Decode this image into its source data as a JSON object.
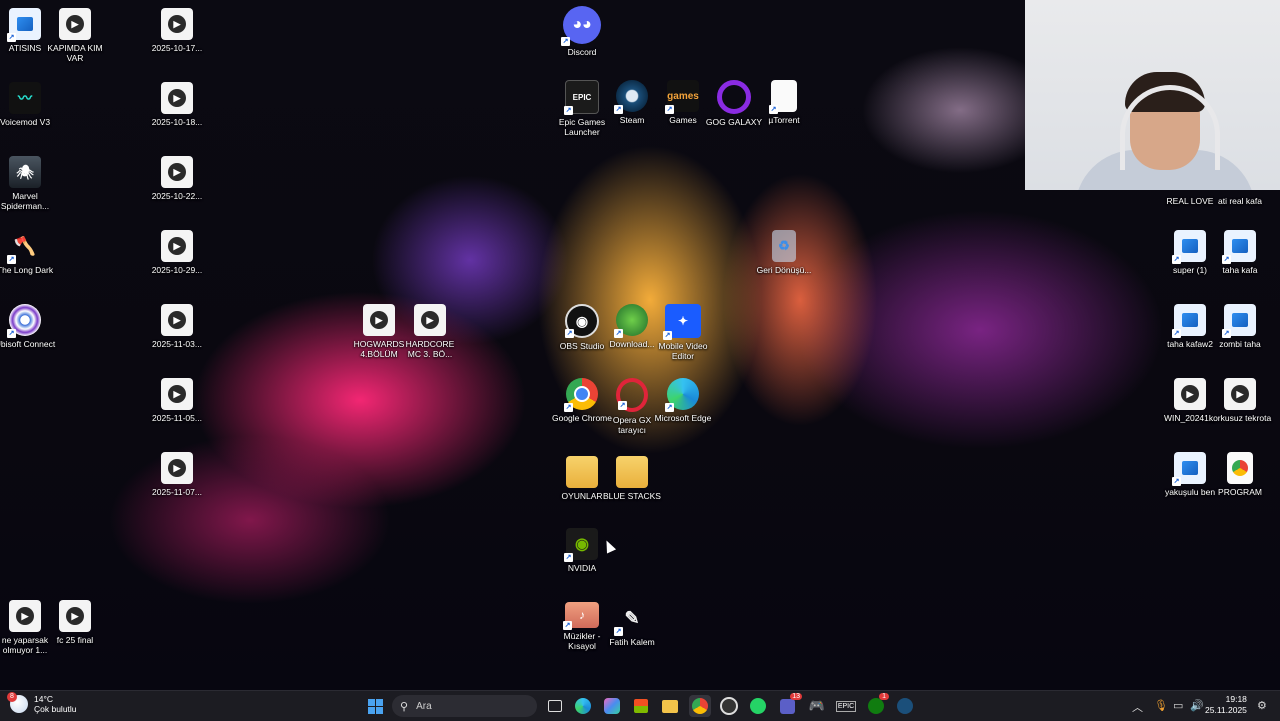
{
  "desktop": {
    "icons": {
      "atisins": {
        "label": "ATISINS"
      },
      "kapimda": {
        "label": "KAPIMDA KIM VAR"
      },
      "voicemod": {
        "label": "Voicemod V3"
      },
      "spiderman": {
        "label": "Marvel Spiderman..."
      },
      "longdark": {
        "label": "The Long Dark"
      },
      "ubisoft": {
        "label": "Ubisoft Connect"
      },
      "v1017": {
        "label": "2025-10-17..."
      },
      "v1018": {
        "label": "2025-10-18..."
      },
      "v1022": {
        "label": "2025-10-22..."
      },
      "v1029": {
        "label": "2025-10-29..."
      },
      "v1103": {
        "label": "2025-11-03..."
      },
      "v1105": {
        "label": "2025-11-05..."
      },
      "v1107": {
        "label": "2025-11-07..."
      },
      "neyaparsak": {
        "label": "ne yaparsak olmuyor 1..."
      },
      "fc25": {
        "label": "fc 25 final"
      },
      "hogwards": {
        "label": "HOGWARDS 4.BÖLÜM"
      },
      "hardcore": {
        "label": "HARDCORE MC 3. BÖ..."
      },
      "discord": {
        "label": "Discord"
      },
      "epic": {
        "label": "Epic Games Launcher"
      },
      "steam": {
        "label": "Steam"
      },
      "amazon": {
        "label": "Games"
      },
      "gog": {
        "label": "GOG GALAXY"
      },
      "utorrent": {
        "label": "µTorrent"
      },
      "recycle": {
        "label": "Geri Dönüşü..."
      },
      "obs": {
        "label": "OBS Studio"
      },
      "download": {
        "label": "Download..."
      },
      "vlc": {
        "label": "Mobile Video Editor"
      },
      "chrome": {
        "label": "Google Chrome"
      },
      "operagx": {
        "label": "Opera GX tarayıcı"
      },
      "edge": {
        "label": "Microsoft Edge"
      },
      "oyunlar": {
        "label": "OYUNLAR"
      },
      "bluestacks": {
        "label": "BLUE STACKS"
      },
      "nvidia": {
        "label": "NVIDIA"
      },
      "muzikler": {
        "label": "Müzikler - Kısayol"
      },
      "fatih": {
        "label": "Fatih Kalem"
      },
      "reallove": {
        "label": "REAL LOVE"
      },
      "atireal": {
        "label": "ati real kafa"
      },
      "super1": {
        "label": "super (1)"
      },
      "tahakafa": {
        "label": "taha kafa"
      },
      "tahakafaw2": {
        "label": "taha kafaw2"
      },
      "zombitaha": {
        "label": "zombi taha"
      },
      "win2024": {
        "label": "WIN_20241..."
      },
      "korkusuz": {
        "label": "korkusuz tekrota"
      },
      "yakusulu": {
        "label": "yakuşulu ben"
      },
      "program": {
        "label": "PROGRAM"
      }
    }
  },
  "taskbar": {
    "weather": {
      "temp": "14°C",
      "desc": "Çok bulutlu",
      "badge": "8"
    },
    "search_placeholder": "Ara",
    "teams_badge": "13",
    "xbox_badge": "1",
    "clock": {
      "time": "19:18",
      "date": "25.11.2025"
    }
  },
  "colors": {
    "taskbar": "#1c1c22",
    "accent": "#3b8eea"
  }
}
